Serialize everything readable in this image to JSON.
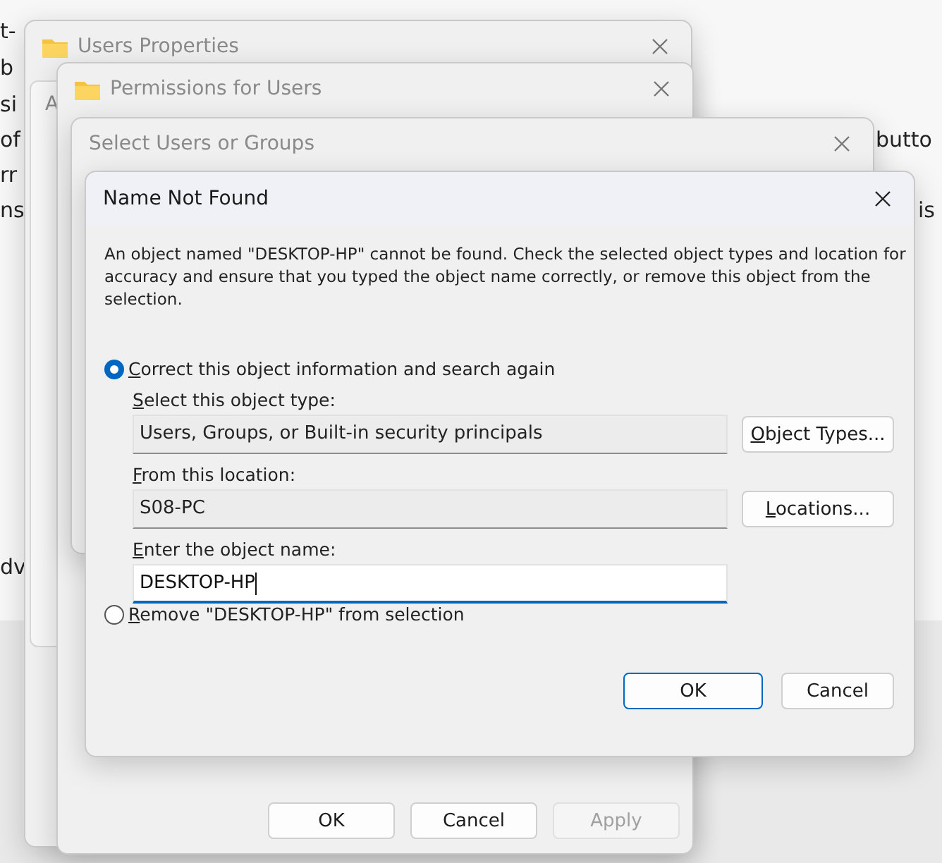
{
  "background_fragments": [
    "t-",
    "b",
    "si",
    "of",
    "rr",
    "ns",
    "dv",
    "butto",
    "is"
  ],
  "users_properties": {
    "title": "Users Properties",
    "tab": "A"
  },
  "permissions": {
    "title": "Permissions for Users",
    "buttons": [
      {
        "label": "OK",
        "disabled": false
      },
      {
        "label": "Cancel",
        "disabled": false
      },
      {
        "label": "Apply",
        "disabled": true
      }
    ]
  },
  "select_users": {
    "title": "Select Users or Groups"
  },
  "dialog": {
    "title": "Name Not Found",
    "message": "An object named \"DESKTOP-HP\" cannot be found. Check the selected object types and location for accuracy and ensure that you typed the object name correctly, or remove this object from the selection.",
    "options": [
      {
        "label": "Correct this object information and search again",
        "selected": true
      },
      {
        "label": "Remove \"DESKTOP-HP\" from selection",
        "selected": false
      }
    ],
    "fields": [
      {
        "kind": "readonly",
        "label": "Select this object type:",
        "value": "Users, Groups, or Built-in security principals",
        "button": "Object Types..."
      },
      {
        "kind": "readonly",
        "label": "From this location:",
        "value": "S08-PC",
        "button": "Locations..."
      },
      {
        "kind": "input",
        "label": "Enter the object name:",
        "value": "DESKTOP-HP"
      }
    ],
    "buttons": [
      {
        "label": "OK",
        "default": true
      },
      {
        "label": "Cancel",
        "default": false
      }
    ]
  }
}
